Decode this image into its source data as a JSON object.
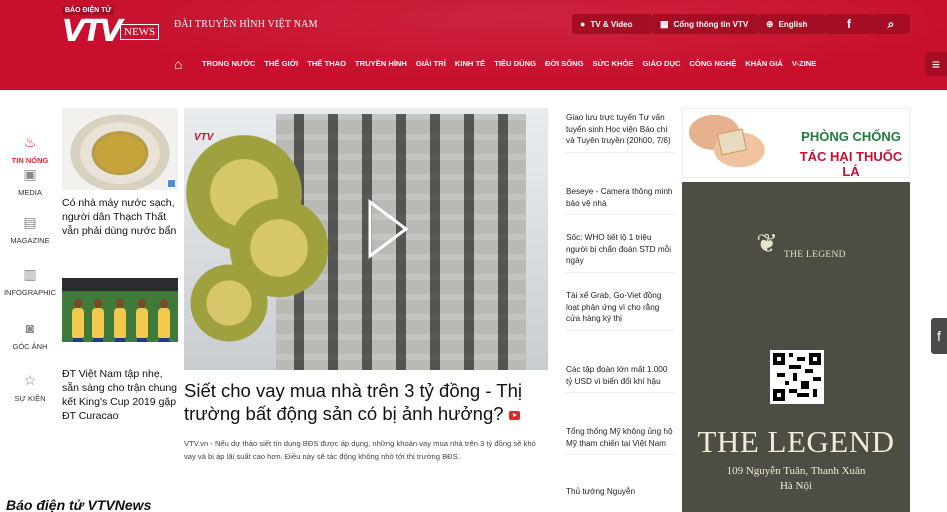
{
  "header": {
    "logo_tag": "BÁO ĐIỆN TỬ",
    "logo_mark": "VTV",
    "logo_suffix": "NEWS",
    "station": "ĐÀI TRUYỀN HÌNH VIỆT NAM",
    "links": {
      "tv_video": "TV & Video",
      "portal": "Cổng thông tin VTV",
      "english": "English",
      "facebook": "f",
      "search": "⌕"
    },
    "brand_color": "#c8102e"
  },
  "nav": {
    "items": [
      "TRONG NƯỚC",
      "THẾ GIỚI",
      "THỂ THAO",
      "TRUYỀN HÌNH",
      "GIẢI TRÍ",
      "KINH TẾ",
      "TIÊU DÙNG",
      "ĐỜI SỐNG",
      "SỨC KHỎE",
      "GIÁO DỤC",
      "CÔNG NGHỆ",
      "KHÁN GIẢ",
      "V-ZINE"
    ]
  },
  "rail": {
    "items": [
      {
        "label": "TIN NÓNG",
        "icon": "flame-icon",
        "active": true
      },
      {
        "label": "MEDIA",
        "icon": "media-icon",
        "active": false
      },
      {
        "label": "MAGAZINE",
        "icon": "magazine-icon",
        "active": false
      },
      {
        "label": "INFOGRAPHIC",
        "icon": "infographic-icon",
        "active": false
      },
      {
        "label": "GÓC ẢNH",
        "icon": "camera-icon",
        "active": false
      },
      {
        "label": "SỰ KIỆN",
        "icon": "star-icon",
        "active": false
      }
    ]
  },
  "left_stories": [
    {
      "title": "Có nhà máy nước sạch, người dân Thạch Thất vẫn phải dùng nước bẩn"
    },
    {
      "title": "ĐT Việt Nam tập nhẹ, sẵn sàng cho trận chung kết King's Cup 2019 gặp ĐT Curacao"
    }
  ],
  "hero": {
    "watermark": "VTV",
    "title": "Siết cho vay mua nhà trên 3 tỷ đồng - Thị trường bất động sản có bị ảnh hưởng?",
    "summary": "VTV.vn - Nếu dự thảo siết tín dụng BĐS được áp dụng, những khoản vay mua nhà trên 3 tỷ đồng sẽ khó vay và bị áp lãi suất cao hơn. Điều này sẽ tác động không nhỏ tới thị trường BĐS."
  },
  "side_list": [
    "Giao lưu trực tuyến Tư vấn tuyển sinh Học viện Báo chí và Tuyên truyền (20h00, 7/6)",
    "Beseye - Camera thông minh bảo vệ nhà",
    "Sốc: WHO tiết lộ 1 triệu người bị chẩn đoán STD mỗi ngày",
    "Tài xế Grab, Go-Viet đồng loạt phản ứng vì cho rằng cửa hàng ký thị",
    "Các tập đoàn lớn mất 1.000 tỷ USD vì biển đổi khí hậu",
    "Tổng thống Mỹ không ủng hộ Mỹ tham chiến tại Việt Nam",
    "Thủ tướng Nguyễn"
  ],
  "ads": {
    "smoke": {
      "line1": "PHÒNG CHỐNG",
      "line2": "TÁC HẠI THUỐC LÁ"
    },
    "legend": {
      "brand_small": "THE LEGEND",
      "brand_big": "THE LEGEND",
      "address_line1": "109 Nguyễn Tuân, Thanh Xuân",
      "address_line2": "Hà Nội",
      "bg_color": "#4d4d43"
    }
  },
  "caption": "Báo điện tử VTVNews"
}
